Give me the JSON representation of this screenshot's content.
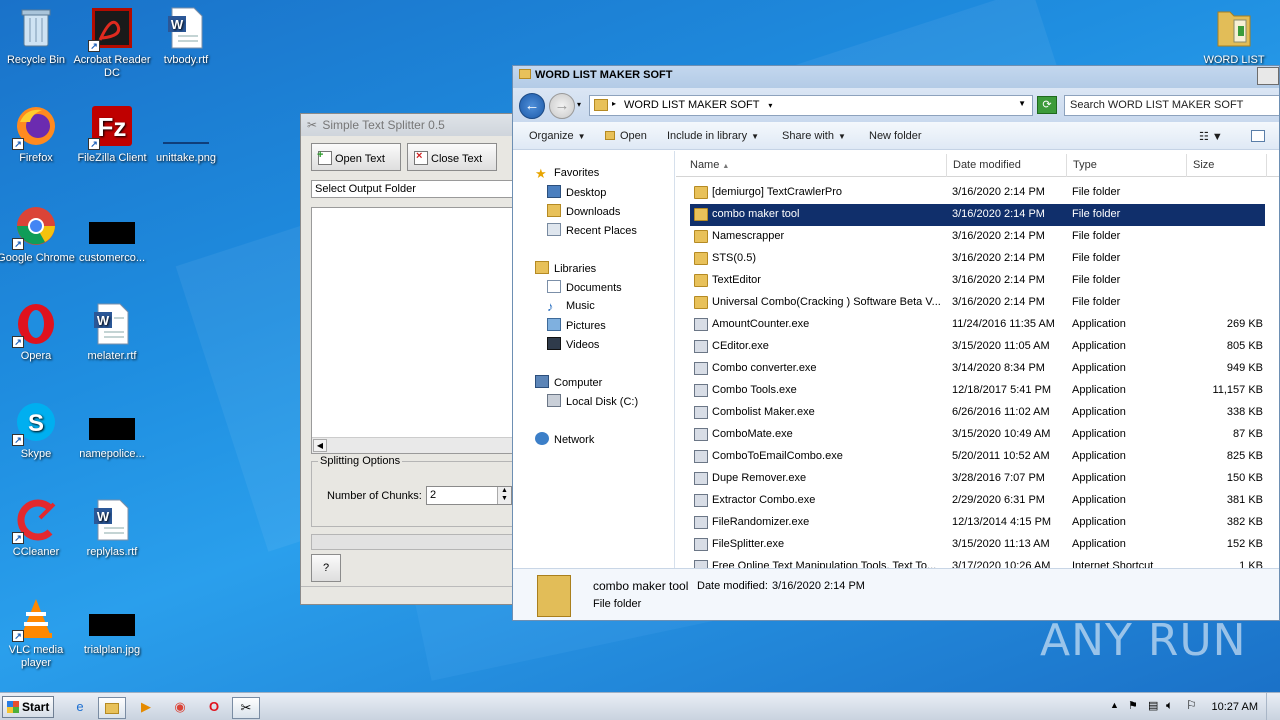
{
  "desktop_icons": [
    {
      "name": "recycle-bin-icon",
      "label": "Recycle Bin"
    },
    {
      "name": "acrobat-icon",
      "label": "Acrobat Reader DC"
    },
    {
      "name": "tvbody-icon",
      "label": "tvbody.rtf"
    },
    {
      "name": "firefox-icon",
      "label": "Firefox"
    },
    {
      "name": "filezilla-icon",
      "label": "FileZilla Client"
    },
    {
      "name": "unittake-icon",
      "label": "unittake.png"
    },
    {
      "name": "chrome-icon",
      "label": "Google Chrome"
    },
    {
      "name": "customerco-icon",
      "label": "customerco..."
    },
    {
      "name": "opera-icon",
      "label": "Opera"
    },
    {
      "name": "melater-icon",
      "label": "melater.rtf"
    },
    {
      "name": "skype-icon",
      "label": "Skype"
    },
    {
      "name": "namepolice-icon",
      "label": "namepolice..."
    },
    {
      "name": "ccleaner-icon",
      "label": "CCleaner"
    },
    {
      "name": "replylas-icon",
      "label": "replylas.rtf"
    },
    {
      "name": "vlc-icon",
      "label": "VLC media player"
    },
    {
      "name": "trialplan-icon",
      "label": "trialplan.jpg"
    },
    {
      "name": "word-list-icon",
      "label": "WORD LIST"
    }
  ],
  "splitter": {
    "title": "Simple Text Splitter 0.5",
    "open_text": "Open Text",
    "close_text": "Close Text",
    "output_folder": "Select Output Folder",
    "options_legend": "Splitting Options",
    "chunks_label": "Number of Chunks:",
    "chunks_value": "2",
    "help": "?"
  },
  "explorer": {
    "title": "WORD LIST MAKER SOFT",
    "address": "WORD LIST MAKER SOFT",
    "search_placeholder": "Search WORD LIST MAKER SOFT",
    "toolbar": {
      "organize": "Organize",
      "open": "Open",
      "include": "Include in library",
      "share": "Share with",
      "new_folder": "New folder"
    },
    "nav": {
      "favorites": "Favorites",
      "desktop": "Desktop",
      "downloads": "Downloads",
      "recent": "Recent Places",
      "libraries": "Libraries",
      "documents": "Documents",
      "music": "Music",
      "pictures": "Pictures",
      "videos": "Videos",
      "computer": "Computer",
      "local_disk": "Local Disk (C:)",
      "network": "Network"
    },
    "columns": {
      "name": "Name",
      "date": "Date modified",
      "type": "Type",
      "size": "Size"
    },
    "files": [
      {
        "name": "[demiurgo] TextCrawlerPro",
        "date": "3/16/2020 2:14 PM",
        "type": "File folder",
        "size": "",
        "kind": "folder"
      },
      {
        "name": "combo maker tool",
        "date": "3/16/2020 2:14 PM",
        "type": "File folder",
        "size": "",
        "kind": "folder"
      },
      {
        "name": "Namescrapper",
        "date": "3/16/2020 2:14 PM",
        "type": "File folder",
        "size": "",
        "kind": "folder"
      },
      {
        "name": "STS(0.5)",
        "date": "3/16/2020 2:14 PM",
        "type": "File folder",
        "size": "",
        "kind": "folder"
      },
      {
        "name": "TextEditor",
        "date": "3/16/2020 2:14 PM",
        "type": "File folder",
        "size": "",
        "kind": "folder"
      },
      {
        "name": "Universal Combo(Cracking ) Software Beta V...",
        "date": "3/16/2020 2:14 PM",
        "type": "File folder",
        "size": "",
        "kind": "folder"
      },
      {
        "name": "AmountCounter.exe",
        "date": "11/24/2016 11:35 AM",
        "type": "Application",
        "size": "269 KB",
        "kind": "app"
      },
      {
        "name": "CEditor.exe",
        "date": "3/15/2020 11:05 AM",
        "type": "Application",
        "size": "805 KB",
        "kind": "app"
      },
      {
        "name": "Combo converter.exe",
        "date": "3/14/2020 8:34 PM",
        "type": "Application",
        "size": "949 KB",
        "kind": "app"
      },
      {
        "name": "Combo Tools.exe",
        "date": "12/18/2017 5:41 PM",
        "type": "Application",
        "size": "11,157 KB",
        "kind": "app"
      },
      {
        "name": "Combolist Maker.exe",
        "date": "6/26/2016 11:02 AM",
        "type": "Application",
        "size": "338 KB",
        "kind": "app"
      },
      {
        "name": "ComboMate.exe",
        "date": "3/15/2020 10:49 AM",
        "type": "Application",
        "size": "87 KB",
        "kind": "app"
      },
      {
        "name": "ComboToEmailCombo.exe",
        "date": "5/20/2011 10:52 AM",
        "type": "Application",
        "size": "825 KB",
        "kind": "app"
      },
      {
        "name": "Dupe Remover.exe",
        "date": "3/28/2016 7:07 PM",
        "type": "Application",
        "size": "150 KB",
        "kind": "app"
      },
      {
        "name": "Extractor Combo.exe",
        "date": "2/29/2020 6:31 PM",
        "type": "Application",
        "size": "381 KB",
        "kind": "app"
      },
      {
        "name": "FileRandomizer.exe",
        "date": "12/13/2014 4:15 PM",
        "type": "Application",
        "size": "382 KB",
        "kind": "app"
      },
      {
        "name": "FileSplitter.exe",
        "date": "3/15/2020 11:13 AM",
        "type": "Application",
        "size": "152 KB",
        "kind": "app"
      },
      {
        "name": "Free Online Text Manipulation Tools, Text To...",
        "date": "3/17/2020 10:26 AM",
        "type": "Internet Shortcut",
        "size": "1 KB",
        "kind": "app"
      }
    ],
    "selected_index": 1,
    "details": {
      "name": "combo maker tool",
      "date_label": "Date modified:",
      "date": "3/16/2020 2:14 PM",
      "type": "File folder"
    }
  },
  "taskbar": {
    "start": "Start",
    "clock": "10:27 AM"
  },
  "watermark": "ANY RUN"
}
